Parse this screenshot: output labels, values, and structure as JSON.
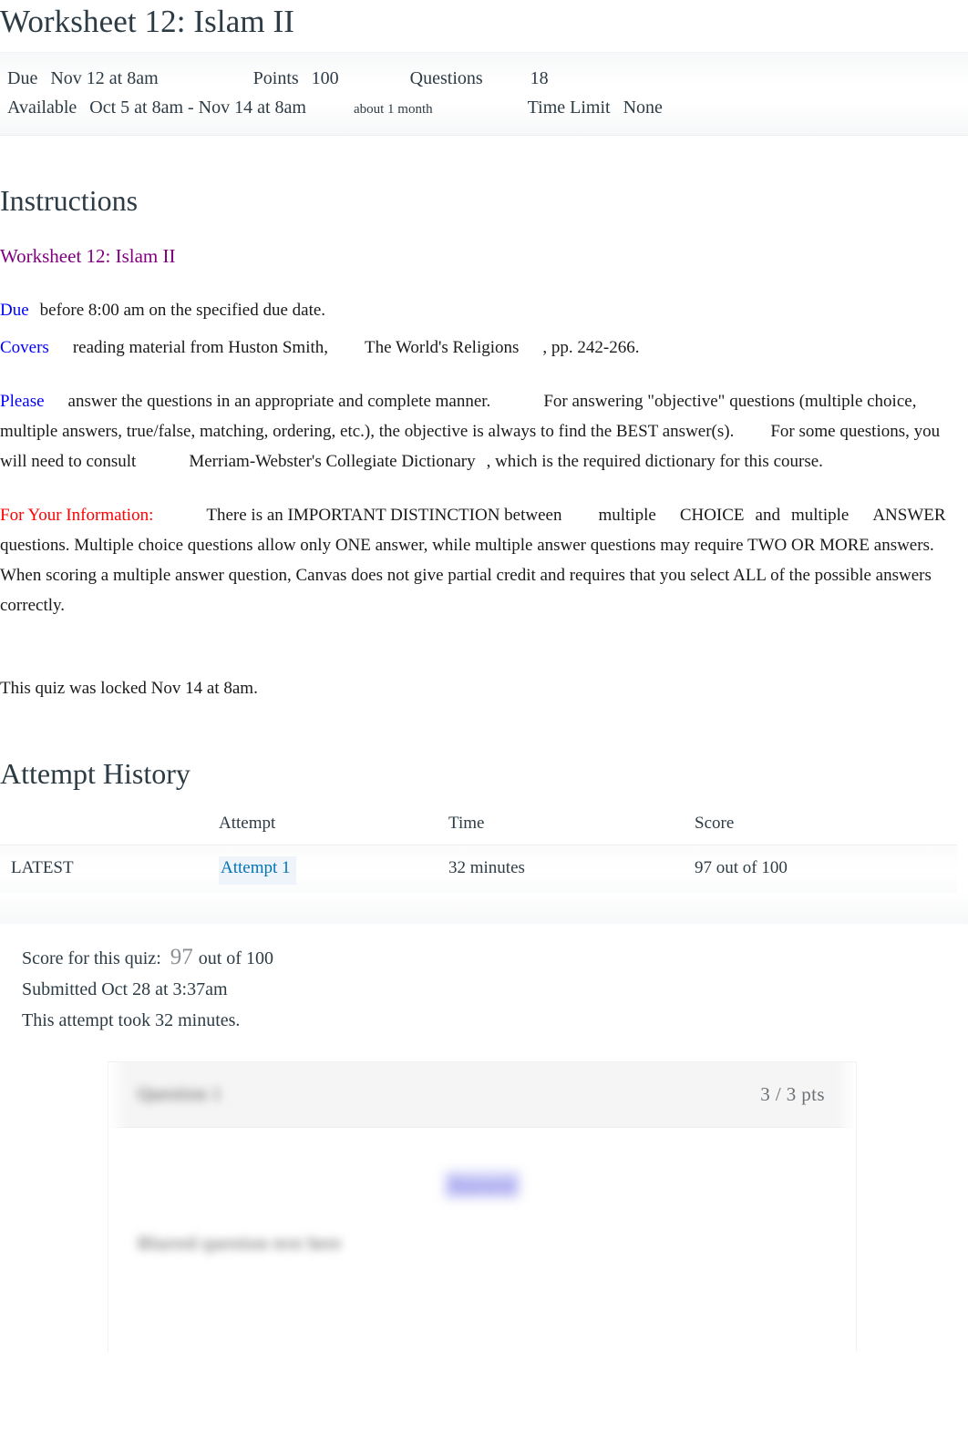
{
  "quiz": {
    "title": "Worksheet 12: Islam II",
    "meta": {
      "due_label": "Due",
      "due_value": "Nov 12 at 8am",
      "points_label": "Points",
      "points_value": "100",
      "questions_label": "Questions",
      "questions_value": "18",
      "available_label": "Available",
      "available_value": "Oct 5 at 8am - Nov 14 at 8am",
      "available_note": "about 1 month",
      "time_limit_label": "Time Limit",
      "time_limit_value": "None"
    }
  },
  "instructions": {
    "heading": "Instructions",
    "subtitle": "Worksheet 12: Islam II",
    "due_keyword": "Due",
    "due_text": "before 8:00 am on the specified due date.",
    "covers_keyword": "Covers",
    "covers_text_a": "reading material from Huston Smith,",
    "covers_text_b": "The World's Religions",
    "covers_text_c": ", pp. 242-266.",
    "please_keyword": "Please",
    "please_text_a": "answer the questions in an appropriate and complete manner.",
    "please_text_b": "For answering \"objective\" questions (multiple choice, multiple answers, true/false, matching, ordering, etc.), the objective is always to find the BEST answer(s).",
    "please_text_c": "For some questions, you will need to consult",
    "please_text_d": "Merriam-Webster's Collegiate Dictionary",
    "please_text_e": ", which is the required dictionary for this course.",
    "fyi_keyword": "For Your Information:",
    "fyi_text_a": "There is an IMPORTANT DISTINCTION between",
    "fyi_text_b": "multiple",
    "fyi_text_c": "CHOICE",
    "fyi_text_d": "and",
    "fyi_text_e": "multiple",
    "fyi_text_f": "ANSWER",
    "fyi_text_g": "questions. Multiple choice questions allow only ONE answer, while multiple answer questions may require TWO OR MORE answers. When scoring a multiple answer question, Canvas does not give partial credit and requires that you select ALL of the possible answers correctly.",
    "locked_note": "This quiz was locked Nov 14 at 8am."
  },
  "attempt_history": {
    "heading": "Attempt History",
    "columns": [
      "",
      "Attempt",
      "Time",
      "Score"
    ],
    "rows": [
      {
        "latest": "LATEST",
        "attempt": "Attempt 1",
        "time": "32 minutes",
        "score": "97 out of 100"
      }
    ]
  },
  "score_summary": {
    "score_label": "Score for this quiz:",
    "score_value": "97",
    "score_out_of": "out of 100",
    "submitted": "Submitted Oct 28 at 3:37am",
    "duration": "This attempt took 32 minutes."
  },
  "question_card": {
    "question_label_blurred": "Question 1",
    "points": "3 / 3 pts",
    "answer_blurred": "Answer",
    "body_blurred": "Blurred question text here"
  },
  "colors": {
    "subtitle_purple": "#800080",
    "keyword_blue": "#0000ff",
    "fyi_red": "#ff0000",
    "link_blue": "#0374b5",
    "heading_slate": "#2d3b45",
    "muted_gray": "#8a8f94"
  }
}
